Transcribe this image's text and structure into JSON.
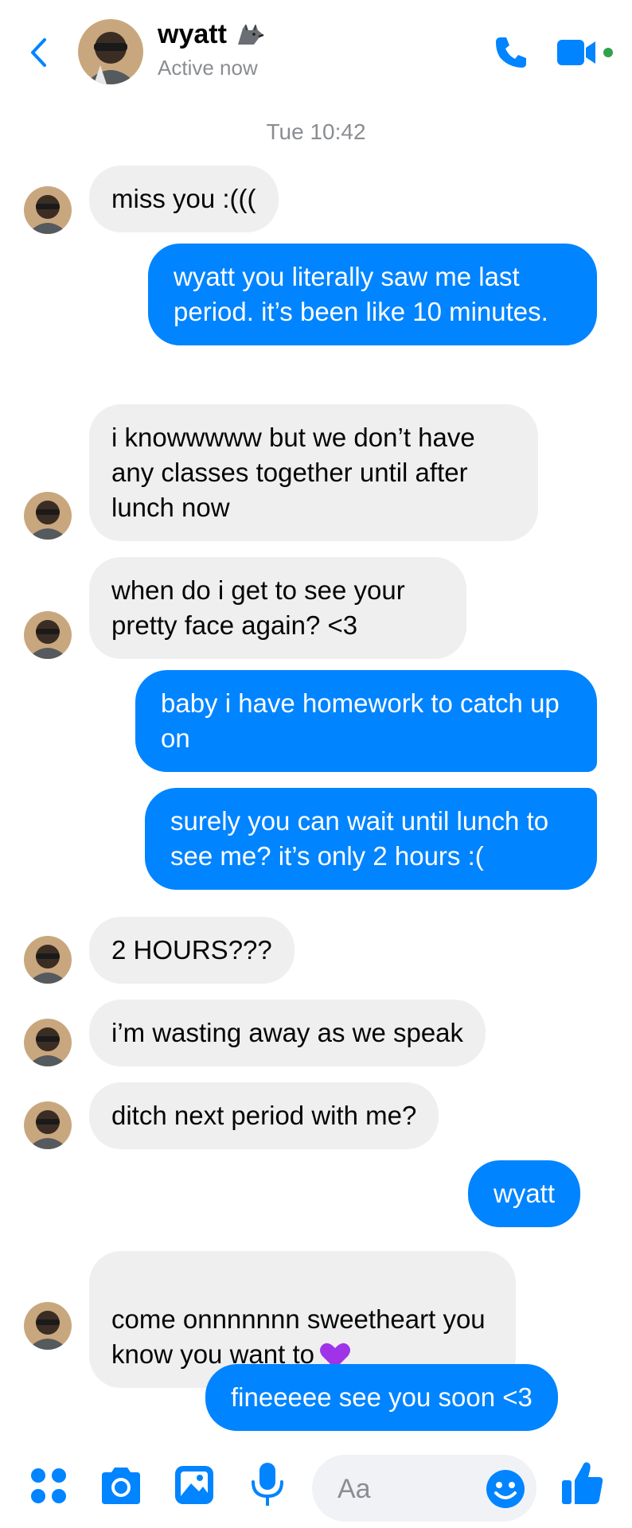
{
  "header": {
    "contact_name": "wyatt",
    "name_emoji_icon": "wolf-icon",
    "status": "Active now",
    "back_icon": "chevron-left-icon",
    "call_icon": "phone-icon",
    "video_icon": "video-camera-icon"
  },
  "timestamp": "Tue 10:42",
  "messages": [
    {
      "direction": "in",
      "text": "miss you :((("
    },
    {
      "direction": "out",
      "text": "wyatt you literally saw me last period. it’s been like 10 minutes."
    },
    {
      "direction": "in",
      "text": "i knowwwww but we don’t have any classes together until after lunch now"
    },
    {
      "direction": "in",
      "text": "when do i get to see your pretty face again? <3"
    },
    {
      "direction": "out",
      "text": "baby i have homework to catch up on"
    },
    {
      "direction": "out",
      "text": "surely you can wait until lunch to see me? it’s only 2 hours :("
    },
    {
      "direction": "in",
      "text": "2 HOURS???"
    },
    {
      "direction": "in",
      "text": "i’m wasting away as we speak"
    },
    {
      "direction": "in",
      "text": "ditch next period with me?"
    },
    {
      "direction": "out",
      "text": "wyatt"
    },
    {
      "direction": "in",
      "text": "come onnnnnnn sweetheart you know you want to",
      "emoji": "purple-heart-icon"
    },
    {
      "direction": "out",
      "text": "fineeeee see you soon <3"
    }
  ],
  "composer": {
    "placeholder": "Aa",
    "icons": [
      "apps-icon",
      "camera-icon",
      "gallery-icon",
      "microphone-icon",
      "emoji-icon",
      "thumbs-up-icon"
    ]
  },
  "colors": {
    "accent": "#0084ff",
    "incoming_bubble": "#efefef",
    "muted_text": "#8a8d91",
    "online_dot": "#31a24c",
    "heart": "#a033e8"
  }
}
